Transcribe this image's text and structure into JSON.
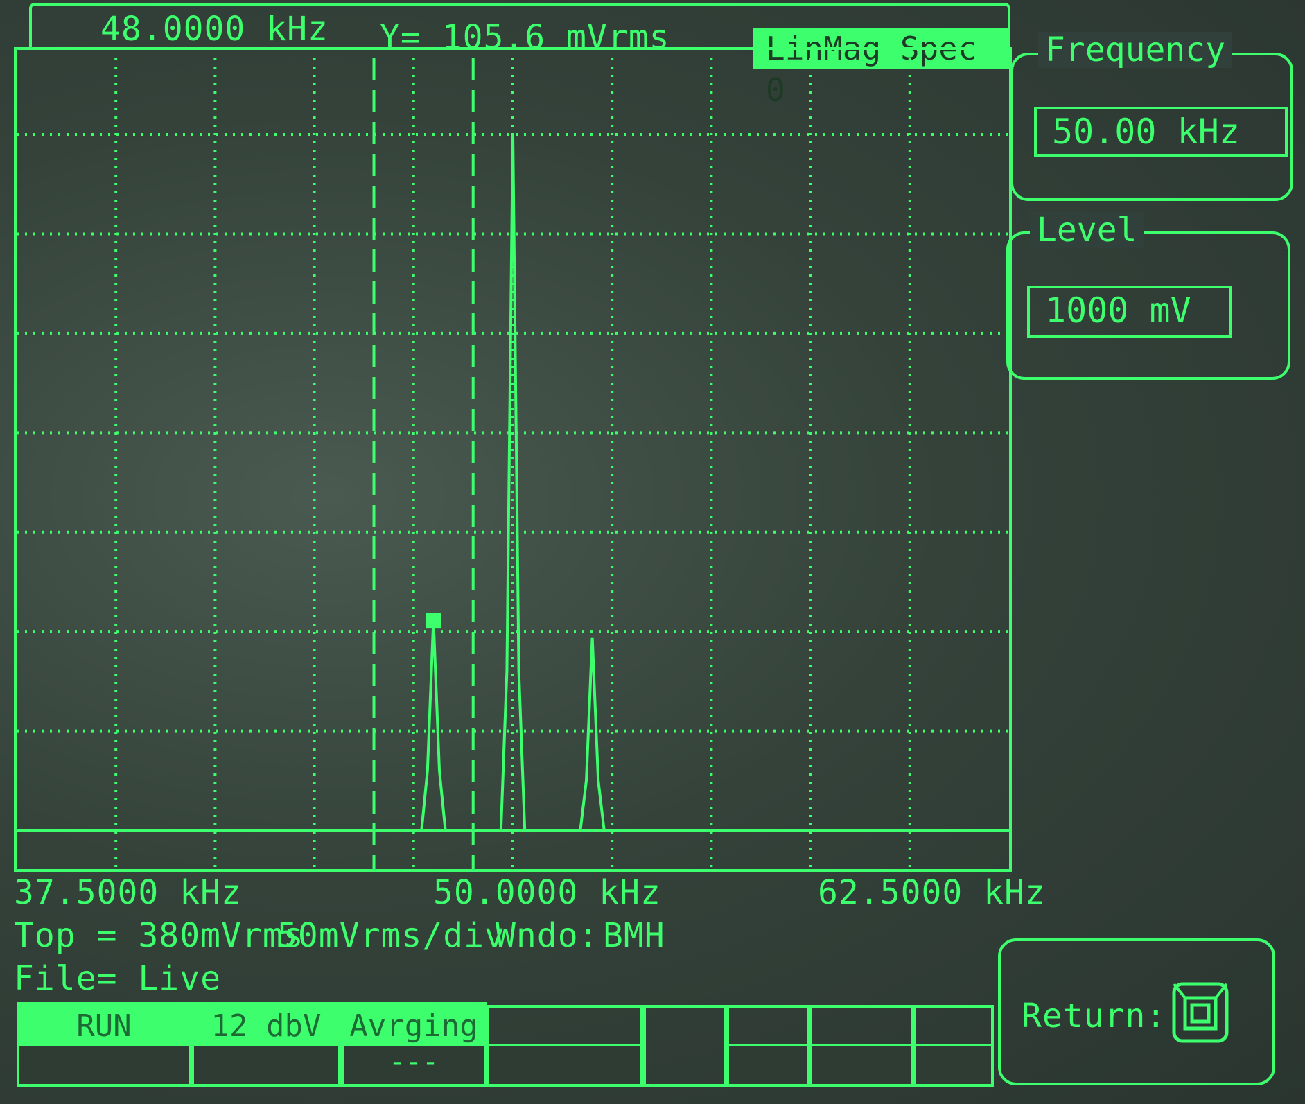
{
  "header": {
    "marker_x": "48.0000 kHz",
    "marker_y": "Y= 105.6 mVrms",
    "trace_name": "LinMag Spec  0"
  },
  "panels": {
    "frequency": {
      "title": "Frequency",
      "value": "50.00 kHz"
    },
    "level": {
      "title": "Level",
      "value": "1000 mV"
    },
    "return": {
      "label": "Return:"
    }
  },
  "axis": {
    "start": "37.5000 kHz",
    "center": "50.0000 kHz",
    "stop": "62.5000 kHz"
  },
  "status": {
    "top": "Top = 380mVrms",
    "scale": "50mVrms/div",
    "window_label": "Wndo:",
    "window_value": "BMH",
    "file": "File= Live"
  },
  "softkeys": [
    {
      "label": "RUN",
      "sub": ""
    },
    {
      "label": "12 dbV",
      "sub": ""
    },
    {
      "label": "Avrging",
      "sub": "---"
    },
    {
      "label": "",
      "sub": ""
    },
    {
      "label": "",
      "sub": ""
    },
    {
      "label": "",
      "sub": ""
    },
    {
      "label": "",
      "sub": ""
    },
    {
      "label": "",
      "sub": ""
    }
  ],
  "chart_data": {
    "type": "line",
    "title": "LinMag Spec  0",
    "x_unit": "kHz",
    "xlim": [
      37.5,
      62.5
    ],
    "ylim": [
      0,
      380
    ],
    "y_unit": "mVrms",
    "grid": true,
    "marker": {
      "x": 48.0,
      "y": 105.6
    },
    "dashed_cursors": [
      46.5,
      49.0
    ],
    "series": [
      {
        "x": [
          37.5,
          47.7,
          47.85,
          48.0,
          48.15,
          48.3,
          49.7,
          49.85,
          50.0,
          50.15,
          50.3,
          51.7,
          51.85,
          52.0,
          52.15,
          52.3,
          62.5
        ],
        "values": [
          0,
          0,
          30,
          105.6,
          30,
          0,
          0,
          80,
          350,
          80,
          0,
          0,
          25,
          97,
          25,
          0,
          0
        ]
      }
    ]
  }
}
